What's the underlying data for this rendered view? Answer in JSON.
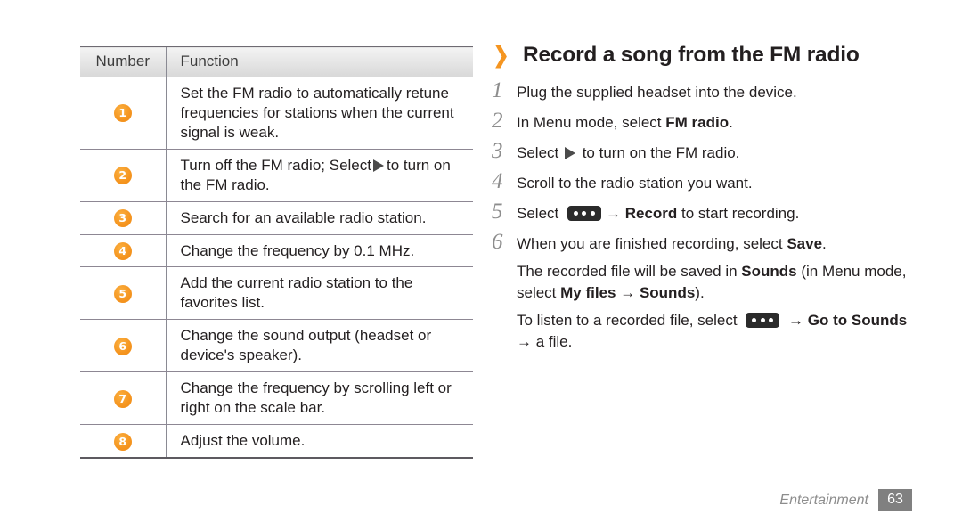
{
  "table": {
    "headers": [
      "Number",
      "Function"
    ],
    "rows": [
      {
        "number": "1",
        "function": "Set the FM radio to automatically retune frequencies for stations when the current signal is weak."
      },
      {
        "number": "2",
        "function_pre": "Turn off the FM radio; Select",
        "icon": "play-icon",
        "function_post": "to turn on the FM radio."
      },
      {
        "number": "3",
        "function": "Search for an available radio station."
      },
      {
        "number": "4",
        "function": "Change the frequency by 0.1 MHz."
      },
      {
        "number": "5",
        "function": "Add the current radio station to the favorites list."
      },
      {
        "number": "6",
        "function": "Change the sound output (headset or device's speaker)."
      },
      {
        "number": "7",
        "function": "Change the frequency by scrolling left or right on the scale bar."
      },
      {
        "number": "8",
        "function": "Adjust the volume."
      }
    ]
  },
  "section": {
    "chevron": "❯",
    "title": "Record a song from the FM radio",
    "steps": [
      {
        "num": "1",
        "text": "Plug the supplied headset into the device."
      },
      {
        "num": "2",
        "pre": "In Menu mode, select ",
        "bold": "FM radio",
        "post": "."
      },
      {
        "num": "3",
        "pre": "Select ",
        "icon": "play-icon",
        "post": " to turn on the FM radio."
      },
      {
        "num": "4",
        "text": "Scroll to the radio station you want."
      },
      {
        "num": "5",
        "pre": "Select ",
        "icon": "dots-menu-icon",
        "arrow": "→ ",
        "bold": "Record",
        "post": " to start recording."
      },
      {
        "num": "6",
        "pre": "When you are finished recording, select ",
        "bold": "Save",
        "post": "."
      }
    ],
    "notes": [
      {
        "p1_a": "The recorded file will be saved in ",
        "p1_b": "Sounds",
        "p1_c": " (in Menu mode, select ",
        "p1_d": "My files",
        "p1_e": " → ",
        "p1_f": "Sounds",
        "p1_g": ")."
      },
      {
        "p2_a": "To listen to a recorded file, select ",
        "p2_icon": "dots-menu-icon",
        "p2_b": " → ",
        "p2_c": "Go to Sounds",
        "p2_d": " → a file."
      }
    ]
  },
  "footer": {
    "label": "Entertainment",
    "page_number": "63"
  },
  "colors": {
    "accent_orange": "#f59520",
    "text": "#231f20",
    "muted": "#8d8d8d",
    "rule": "#8d8793",
    "header_bg": "#e4e4e4",
    "page_box": "#808080"
  }
}
